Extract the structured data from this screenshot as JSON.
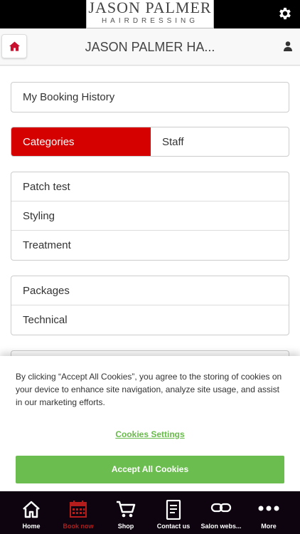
{
  "header": {
    "logo_main": "JASON PALMER",
    "logo_sub": "HAIRDRESSING"
  },
  "navbar": {
    "title": "JASON PALMER HA..."
  },
  "booking_history": "My Booking History",
  "tabs": [
    {
      "label": "Categories",
      "active": true
    },
    {
      "label": "Staff",
      "active": false
    }
  ],
  "categories_group1": [
    "Patch test",
    "Styling",
    "Treatment"
  ],
  "categories_group2": [
    "Packages",
    "Technical"
  ],
  "cookie_banner": {
    "text": "By clicking “Accept All Cookies”, you agree to the storing of cookies on your device to enhance site navigation, analyze site usage, and assist in our marketing efforts.",
    "settings_label": "Cookies Settings",
    "accept_label": "Accept All Cookies"
  },
  "bottom_tabs": [
    {
      "label": "Home",
      "icon": "home-icon"
    },
    {
      "label": "Book now",
      "icon": "calendar-icon",
      "active": true
    },
    {
      "label": "Shop",
      "icon": "cart-icon"
    },
    {
      "label": "Contact us",
      "icon": "contact-icon"
    },
    {
      "label": "Salon webs...",
      "icon": "link-icon"
    },
    {
      "label": "More",
      "icon": "more-icon"
    }
  ],
  "colors": {
    "accent_red": "#d50000",
    "cookie_green": "#6abd4e",
    "tabbar_bg": "#0d0410"
  }
}
